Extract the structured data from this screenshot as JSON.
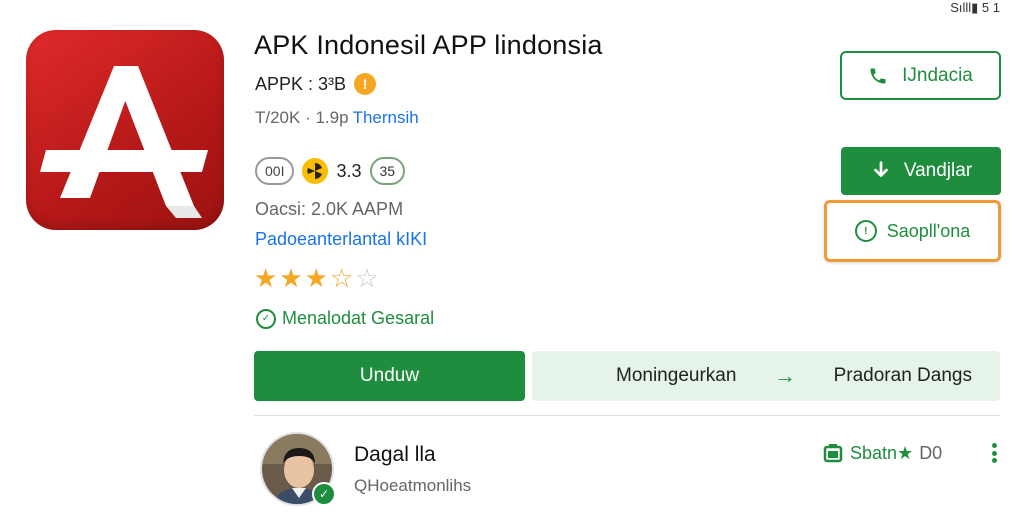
{
  "status_bar": {
    "text": "Sılll▮ 5 1"
  },
  "app": {
    "title": "APK Indonesil APP lindonsia",
    "size": "APPK : 3³B",
    "dev_prefix": "T/20K · 1.9p",
    "dev_link": "Thernsih",
    "stats": {
      "pill1": "00I",
      "rating": "3.3",
      "pill2": "35"
    },
    "info": "Oacsi: 2.0K AAPM",
    "link": "Padoeanterlantal kIKI",
    "stars": {
      "filled": 3,
      "half": 1,
      "empty": 1,
      "max": 5
    },
    "general": "Menalodat Gesaral"
  },
  "buttons": {
    "outline": "IJndacia",
    "green": "Vandjlar",
    "orange": "Saopll'ona",
    "unduh": "Unduw",
    "wide_left": "Moningeurkan",
    "wide_right": "Pradoran Dangs"
  },
  "user": {
    "name": "Dagal lla",
    "handle": "QHoeatmonlihs",
    "right_label": "Sbatn★",
    "right_value": "D0"
  },
  "colors": {
    "brand_red": "#c81e1e",
    "green": "#1e8e3e",
    "orange_border": "#f29a38",
    "link_blue": "#1a73e8"
  },
  "icons": [
    "app-logo-icon",
    "info-icon",
    "phone-icon",
    "download-icon",
    "clock-icon",
    "check-circle-icon",
    "arrow-right-icon",
    "verified-icon",
    "battery-icon",
    "more-vert-icon"
  ]
}
